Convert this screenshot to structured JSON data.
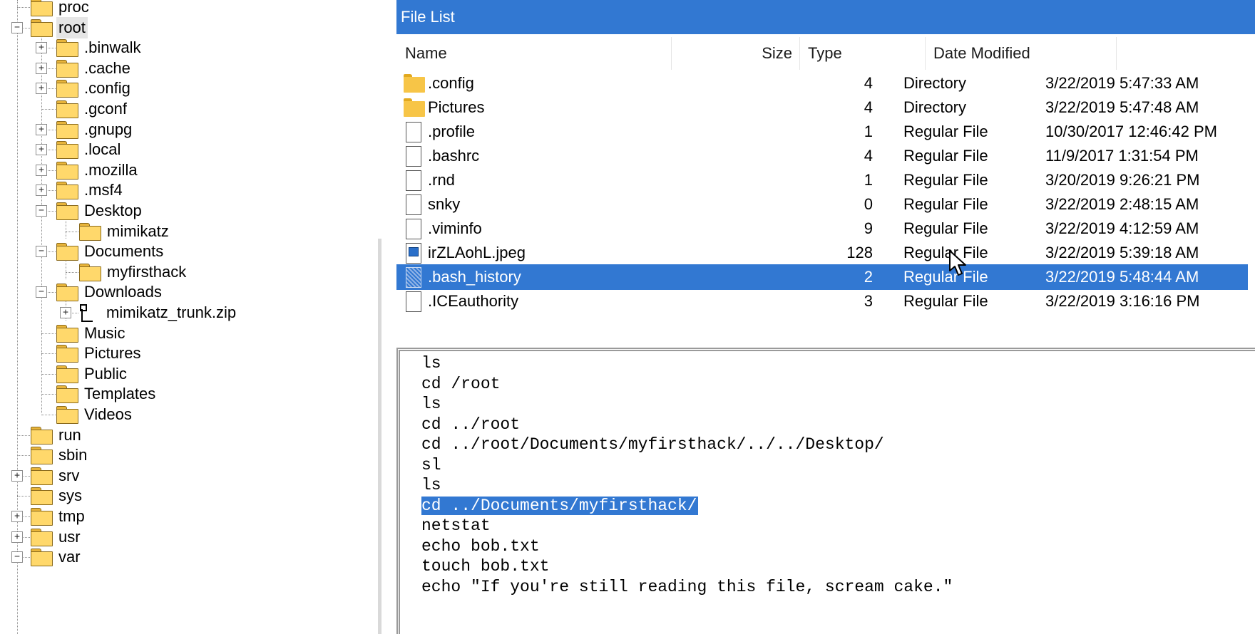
{
  "tree": {
    "items": [
      {
        "label": "proc",
        "level": 0,
        "expander": "none",
        "selected": false
      },
      {
        "label": "root",
        "level": 0,
        "expander": "minus",
        "selected": true
      },
      {
        "label": ".binwalk",
        "level": 1,
        "expander": "plus"
      },
      {
        "label": ".cache",
        "level": 1,
        "expander": "plus"
      },
      {
        "label": ".config",
        "level": 1,
        "expander": "plus"
      },
      {
        "label": ".gconf",
        "level": 1,
        "expander": "none"
      },
      {
        "label": ".gnupg",
        "level": 1,
        "expander": "plus"
      },
      {
        "label": ".local",
        "level": 1,
        "expander": "plus"
      },
      {
        "label": ".mozilla",
        "level": 1,
        "expander": "plus"
      },
      {
        "label": ".msf4",
        "level": 1,
        "expander": "plus"
      },
      {
        "label": "Desktop",
        "level": 1,
        "expander": "minus"
      },
      {
        "label": "mimikatz",
        "level": 2,
        "expander": "none"
      },
      {
        "label": "Documents",
        "level": 1,
        "expander": "minus"
      },
      {
        "label": "myfirsthack",
        "level": 2,
        "expander": "none"
      },
      {
        "label": "Downloads",
        "level": 1,
        "expander": "minus"
      },
      {
        "label": "mimikatz_trunk.zip",
        "level": 2,
        "expander": "plus",
        "icon": "archive-icon"
      },
      {
        "label": "Music",
        "level": 1,
        "expander": "none"
      },
      {
        "label": "Pictures",
        "level": 1,
        "expander": "none"
      },
      {
        "label": "Public",
        "level": 1,
        "expander": "none"
      },
      {
        "label": "Templates",
        "level": 1,
        "expander": "none"
      },
      {
        "label": "Videos",
        "level": 1,
        "expander": "none"
      },
      {
        "label": "run",
        "level": 0,
        "expander": "none"
      },
      {
        "label": "sbin",
        "level": 0,
        "expander": "none"
      },
      {
        "label": "srv",
        "level": 0,
        "expander": "plus"
      },
      {
        "label": "sys",
        "level": 0,
        "expander": "none"
      },
      {
        "label": "tmp",
        "level": 0,
        "expander": "plus"
      },
      {
        "label": "usr",
        "level": 0,
        "expander": "plus"
      },
      {
        "label": "var",
        "level": 0,
        "expander": "minus"
      }
    ]
  },
  "file_list": {
    "title": "File List",
    "columns": {
      "name": "Name",
      "size": "Size",
      "type": "Type",
      "date": "Date Modified"
    },
    "rows": [
      {
        "icon": "folder-icon",
        "name": ".config",
        "size": "4",
        "type": "Directory",
        "date": "3/22/2019 5:47:33 AM",
        "selected": false
      },
      {
        "icon": "folder-icon",
        "name": "Pictures",
        "size": "4",
        "type": "Directory",
        "date": "3/22/2019 5:47:48 AM",
        "selected": false
      },
      {
        "icon": "file-icon",
        "name": ".profile",
        "size": "1",
        "type": "Regular File",
        "date": "10/30/2017 12:46:42 PM",
        "selected": false
      },
      {
        "icon": "file-icon",
        "name": ".bashrc",
        "size": "4",
        "type": "Regular File",
        "date": "11/9/2017 1:31:54 PM",
        "selected": false
      },
      {
        "icon": "file-icon",
        "name": ".rnd",
        "size": "1",
        "type": "Regular File",
        "date": "3/20/2019 9:26:21 PM",
        "selected": false
      },
      {
        "icon": "file-icon",
        "name": "snky",
        "size": "0",
        "type": "Regular File",
        "date": "3/22/2019 2:48:15 AM",
        "selected": false
      },
      {
        "icon": "file-icon",
        "name": ".viminfo",
        "size": "9",
        "type": "Regular File",
        "date": "3/22/2019 4:12:59 AM",
        "selected": false
      },
      {
        "icon": "image-file-icon",
        "name": "irZLAohL.jpeg",
        "size": "128",
        "type": "Regular File",
        "date": "3/22/2019 5:39:18 AM",
        "selected": false
      },
      {
        "icon": "text-file-icon",
        "name": ".bash_history",
        "size": "2",
        "type": "Regular File",
        "date": "3/22/2019 5:48:44 AM",
        "selected": true
      },
      {
        "icon": "file-icon",
        "name": ".ICEauthority",
        "size": "3",
        "type": "Regular File",
        "date": "3/22/2019 3:16:16 PM",
        "selected": false
      }
    ]
  },
  "viewer": {
    "lines": [
      {
        "text": "ls",
        "selected": false
      },
      {
        "text": "cd /root",
        "selected": false
      },
      {
        "text": "ls",
        "selected": false
      },
      {
        "text": "cd ../root",
        "selected": false
      },
      {
        "text": "cd ../root/Documents/myfirsthack/../../Desktop/",
        "selected": false
      },
      {
        "text": "sl",
        "selected": false
      },
      {
        "text": "ls",
        "selected": false
      },
      {
        "text": "cd ../Documents/myfirsthack/",
        "selected": true
      },
      {
        "text": "netstat",
        "selected": false
      },
      {
        "text": "echo bob.txt",
        "selected": false
      },
      {
        "text": "touch bob.txt",
        "selected": false
      },
      {
        "text": "echo \"If you're still reading this file, scream cake.\"",
        "selected": false
      }
    ]
  },
  "colors": {
    "accent": "#3278d2",
    "folder": "#ffd86b",
    "tree_lines": "#8c8c8c"
  }
}
